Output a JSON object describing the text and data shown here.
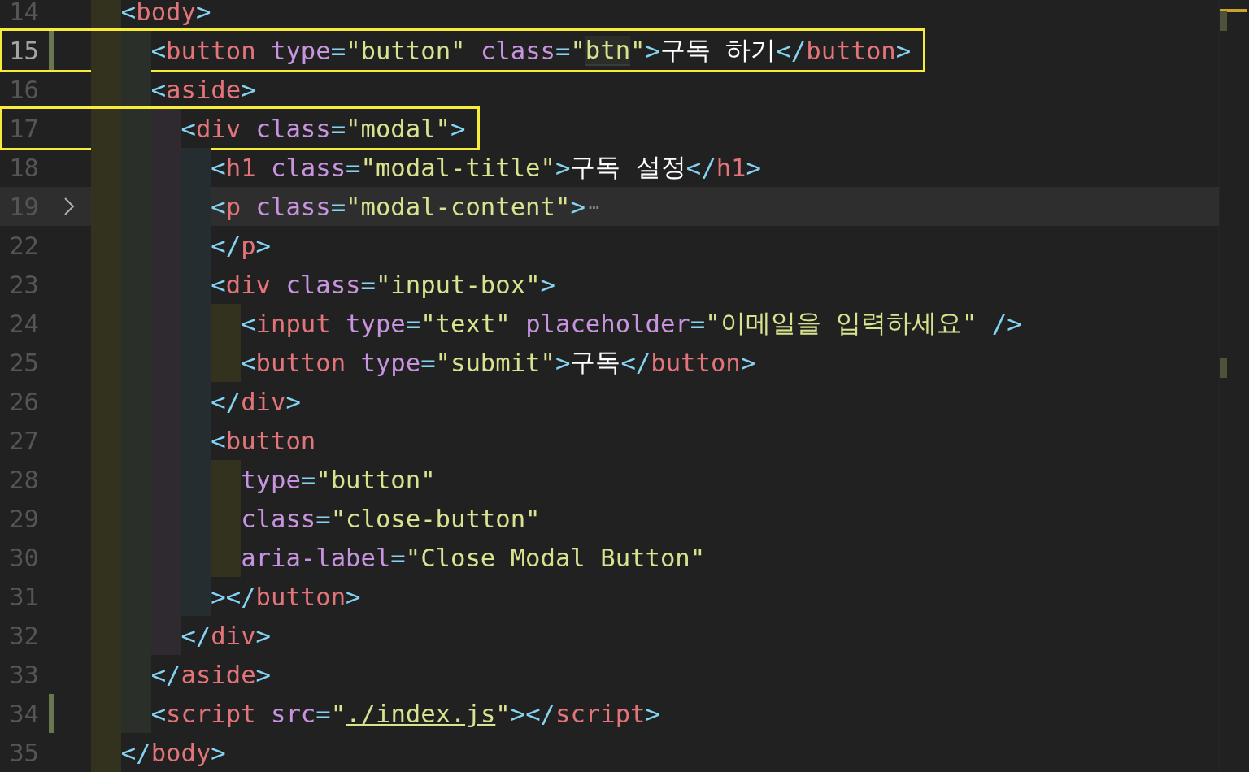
{
  "editor": {
    "lines": [
      {
        "number": "14",
        "active": false,
        "highlighted": false,
        "changed": false,
        "folded": false,
        "boxed": false,
        "tokens": [
          {
            "kind": "punct",
            "text": "<"
          },
          {
            "kind": "tag",
            "text": "body"
          },
          {
            "kind": "punct",
            "text": ">"
          }
        ],
        "children": [
          {
            "number": "15",
            "active": true,
            "highlighted": false,
            "changed": true,
            "folded": false,
            "boxed": true,
            "tokens": [
              {
                "kind": "punct",
                "text": "<"
              },
              {
                "kind": "tag",
                "text": "button"
              },
              {
                "kind": "attr",
                "text": " type"
              },
              {
                "kind": "punct",
                "text": "="
              },
              {
                "kind": "string",
                "text": "\"button\""
              },
              {
                "kind": "attr",
                "text": " class"
              },
              {
                "kind": "punct",
                "text": "="
              },
              {
                "kind": "string",
                "text": "\""
              },
              {
                "kind": "match",
                "text": "btn"
              },
              {
                "kind": "string",
                "text": "\""
              },
              {
                "kind": "punct",
                "text": ">"
              },
              {
                "kind": "text",
                "text": "구독 하기"
              },
              {
                "kind": "punct",
                "text": "</"
              },
              {
                "kind": "tag",
                "text": "button"
              },
              {
                "kind": "punct",
                "text": ">"
              }
            ]
          },
          {
            "number": "16",
            "active": false,
            "highlighted": false,
            "changed": false,
            "folded": false,
            "boxed": false,
            "tokens": [
              {
                "kind": "punct",
                "text": "<"
              },
              {
                "kind": "tag",
                "text": "aside"
              },
              {
                "kind": "punct",
                "text": ">"
              }
            ],
            "children": [
              {
                "number": "17",
                "active": false,
                "highlighted": false,
                "changed": false,
                "folded": false,
                "boxed": true,
                "tokens": [
                  {
                    "kind": "punct",
                    "text": "<"
                  },
                  {
                    "kind": "tag",
                    "text": "div"
                  },
                  {
                    "kind": "attr",
                    "text": " class"
                  },
                  {
                    "kind": "punct",
                    "text": "="
                  },
                  {
                    "kind": "string",
                    "text": "\"modal\""
                  },
                  {
                    "kind": "punct",
                    "text": ">"
                  }
                ],
                "children": [
                  {
                    "number": "18",
                    "active": false,
                    "highlighted": false,
                    "changed": false,
                    "folded": false,
                    "boxed": false,
                    "tokens": [
                      {
                        "kind": "punct",
                        "text": "<"
                      },
                      {
                        "kind": "tag",
                        "text": "h1"
                      },
                      {
                        "kind": "attr",
                        "text": " class"
                      },
                      {
                        "kind": "punct",
                        "text": "="
                      },
                      {
                        "kind": "string",
                        "text": "\"modal-title\""
                      },
                      {
                        "kind": "punct",
                        "text": ">"
                      },
                      {
                        "kind": "text",
                        "text": "구독 설정"
                      },
                      {
                        "kind": "punct",
                        "text": "</"
                      },
                      {
                        "kind": "tag",
                        "text": "h1"
                      },
                      {
                        "kind": "punct",
                        "text": ">"
                      }
                    ]
                  },
                  {
                    "number": "19",
                    "active": false,
                    "highlighted": true,
                    "changed": false,
                    "folded": true,
                    "boxed": false,
                    "tokens": [
                      {
                        "kind": "punct",
                        "text": "<"
                      },
                      {
                        "kind": "tag",
                        "text": "p"
                      },
                      {
                        "kind": "attr",
                        "text": " class"
                      },
                      {
                        "kind": "punct",
                        "text": "="
                      },
                      {
                        "kind": "string",
                        "text": "\"modal-content\""
                      },
                      {
                        "kind": "punct",
                        "text": ">"
                      },
                      {
                        "kind": "fold",
                        "text": "⋯"
                      }
                    ]
                  },
                  {
                    "number": "22",
                    "active": false,
                    "highlighted": false,
                    "changed": false,
                    "folded": false,
                    "boxed": false,
                    "tokens": [
                      {
                        "kind": "punct",
                        "text": "</"
                      },
                      {
                        "kind": "tag",
                        "text": "p"
                      },
                      {
                        "kind": "punct",
                        "text": ">"
                      }
                    ]
                  },
                  {
                    "number": "23",
                    "active": false,
                    "highlighted": false,
                    "changed": false,
                    "folded": false,
                    "boxed": false,
                    "tokens": [
                      {
                        "kind": "punct",
                        "text": "<"
                      },
                      {
                        "kind": "tag",
                        "text": "div"
                      },
                      {
                        "kind": "attr",
                        "text": " class"
                      },
                      {
                        "kind": "punct",
                        "text": "="
                      },
                      {
                        "kind": "string",
                        "text": "\"input-box\""
                      },
                      {
                        "kind": "punct",
                        "text": ">"
                      }
                    ],
                    "children": [
                      {
                        "number": "24",
                        "active": false,
                        "highlighted": false,
                        "changed": false,
                        "folded": false,
                        "boxed": false,
                        "tokens": [
                          {
                            "kind": "punct",
                            "text": "<"
                          },
                          {
                            "kind": "tag",
                            "text": "input"
                          },
                          {
                            "kind": "attr",
                            "text": " type"
                          },
                          {
                            "kind": "punct",
                            "text": "="
                          },
                          {
                            "kind": "string",
                            "text": "\"text\""
                          },
                          {
                            "kind": "attr",
                            "text": " placeholder"
                          },
                          {
                            "kind": "punct",
                            "text": "="
                          },
                          {
                            "kind": "string",
                            "text": "\"이메일을 입력하세요\""
                          },
                          {
                            "kind": "punct",
                            "text": " />"
                          }
                        ]
                      },
                      {
                        "number": "25",
                        "active": false,
                        "highlighted": false,
                        "changed": false,
                        "folded": false,
                        "boxed": false,
                        "tokens": [
                          {
                            "kind": "punct",
                            "text": "<"
                          },
                          {
                            "kind": "tag",
                            "text": "button"
                          },
                          {
                            "kind": "attr",
                            "text": " type"
                          },
                          {
                            "kind": "punct",
                            "text": "="
                          },
                          {
                            "kind": "string",
                            "text": "\"submit\""
                          },
                          {
                            "kind": "punct",
                            "text": ">"
                          },
                          {
                            "kind": "text",
                            "text": "구독"
                          },
                          {
                            "kind": "punct",
                            "text": "</"
                          },
                          {
                            "kind": "tag",
                            "text": "button"
                          },
                          {
                            "kind": "punct",
                            "text": ">"
                          }
                        ]
                      }
                    ]
                  },
                  {
                    "number": "26",
                    "active": false,
                    "highlighted": false,
                    "changed": false,
                    "folded": false,
                    "boxed": false,
                    "tokens": [
                      {
                        "kind": "punct",
                        "text": "</"
                      },
                      {
                        "kind": "tag",
                        "text": "div"
                      },
                      {
                        "kind": "punct",
                        "text": ">"
                      }
                    ]
                  },
                  {
                    "number": "27",
                    "active": false,
                    "highlighted": false,
                    "changed": false,
                    "folded": false,
                    "boxed": false,
                    "tokens": [
                      {
                        "kind": "punct",
                        "text": "<"
                      },
                      {
                        "kind": "tag",
                        "text": "button"
                      }
                    ],
                    "children": [
                      {
                        "number": "28",
                        "active": false,
                        "highlighted": false,
                        "changed": false,
                        "folded": false,
                        "boxed": false,
                        "tokens": [
                          {
                            "kind": "attr",
                            "text": "type"
                          },
                          {
                            "kind": "punct",
                            "text": "="
                          },
                          {
                            "kind": "string",
                            "text": "\"button\""
                          }
                        ]
                      },
                      {
                        "number": "29",
                        "active": false,
                        "highlighted": false,
                        "changed": false,
                        "folded": false,
                        "boxed": false,
                        "tokens": [
                          {
                            "kind": "attr",
                            "text": "class"
                          },
                          {
                            "kind": "punct",
                            "text": "="
                          },
                          {
                            "kind": "string",
                            "text": "\"close-button\""
                          }
                        ]
                      },
                      {
                        "number": "30",
                        "active": false,
                        "highlighted": false,
                        "changed": false,
                        "folded": false,
                        "boxed": false,
                        "tokens": [
                          {
                            "kind": "attr",
                            "text": "aria-label"
                          },
                          {
                            "kind": "punct",
                            "text": "="
                          },
                          {
                            "kind": "string",
                            "text": "\"Close Modal Button\""
                          }
                        ]
                      }
                    ]
                  },
                  {
                    "number": "31",
                    "active": false,
                    "highlighted": false,
                    "changed": false,
                    "folded": false,
                    "boxed": false,
                    "tokens": [
                      {
                        "kind": "punct",
                        "text": "></"
                      },
                      {
                        "kind": "tag",
                        "text": "button"
                      },
                      {
                        "kind": "punct",
                        "text": ">"
                      }
                    ]
                  }
                ]
              },
              {
                "number": "32",
                "active": false,
                "highlighted": false,
                "changed": false,
                "folded": false,
                "boxed": false,
                "tokens": [
                  {
                    "kind": "punct",
                    "text": "</"
                  },
                  {
                    "kind": "tag",
                    "text": "div"
                  },
                  {
                    "kind": "punct",
                    "text": ">"
                  }
                ]
              }
            ]
          },
          {
            "number": "33",
            "active": false,
            "highlighted": false,
            "changed": false,
            "folded": false,
            "boxed": false,
            "tokens": [
              {
                "kind": "punct",
                "text": "</"
              },
              {
                "kind": "tag",
                "text": "aside"
              },
              {
                "kind": "punct",
                "text": ">"
              }
            ]
          },
          {
            "number": "34",
            "active": false,
            "highlighted": false,
            "changed": true,
            "folded": false,
            "boxed": false,
            "tokens": [
              {
                "kind": "punct",
                "text": "<"
              },
              {
                "kind": "tag",
                "text": "script"
              },
              {
                "kind": "attr",
                "text": " src"
              },
              {
                "kind": "punct",
                "text": "="
              },
              {
                "kind": "string",
                "text": "\""
              },
              {
                "kind": "link",
                "text": "./index.js"
              },
              {
                "kind": "string",
                "text": "\""
              },
              {
                "kind": "punct",
                "text": "></"
              },
              {
                "kind": "tag",
                "text": "script"
              },
              {
                "kind": "punct",
                "text": ">"
              }
            ]
          }
        ]
      },
      {
        "number": "35",
        "active": false,
        "highlighted": false,
        "changed": false,
        "folded": false,
        "boxed": false,
        "tokens": [
          {
            "kind": "punct",
            "text": "</"
          },
          {
            "kind": "tag",
            "text": "body"
          },
          {
            "kind": "punct",
            "text": ">"
          }
        ]
      }
    ]
  }
}
